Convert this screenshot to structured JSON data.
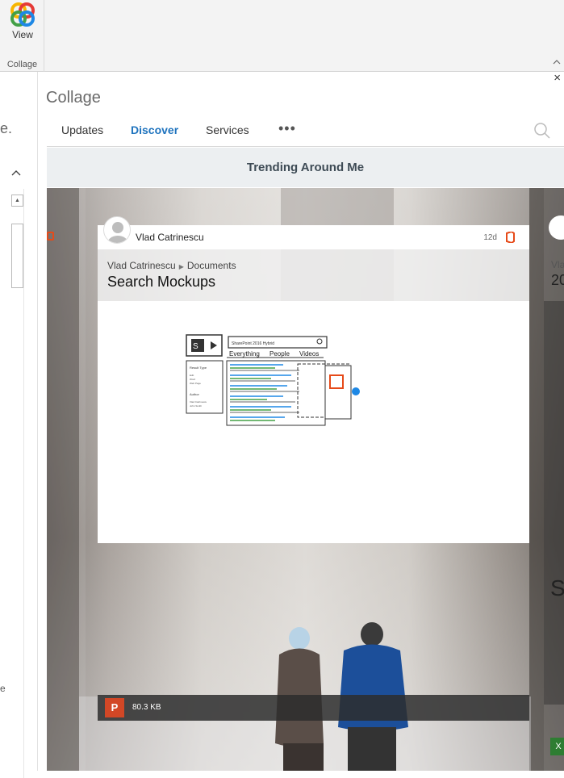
{
  "ribbon": {
    "view_label": "View",
    "group_label": "Collage"
  },
  "left_pane": {
    "partial_text": "e.",
    "partial_text_2": "e"
  },
  "panel": {
    "title": "Collage",
    "close_glyph": "×",
    "tabs": [
      {
        "label": "Updates",
        "active": false
      },
      {
        "label": "Discover",
        "active": true
      },
      {
        "label": "Services",
        "active": false
      }
    ],
    "more_glyph": "•••",
    "section_title": "Trending Around Me"
  },
  "card": {
    "author": "Vlad Catrinescu",
    "age": "12d",
    "breadcrumb": [
      "Vlad Catrinescu",
      "Documents"
    ],
    "title": "Search Mockups",
    "file_type": "P",
    "file_size": "80.3 KB"
  },
  "side_card_right": {
    "author_partial": "Vla",
    "title_partial": "20",
    "partial_char": "S"
  },
  "mockup": {
    "search_text": "SharePoint 2016 Hybrid",
    "tabs": [
      "Everything",
      "People",
      "Videos"
    ],
    "refiner_title": "Result Type",
    "refiner_items": [
      "Edit",
      "Word",
      "Web Page"
    ],
    "author_title": "Author",
    "author_items": [
      "Vlad Catrinescu",
      "John Smith"
    ]
  },
  "colors": {
    "accent": "#1e73be",
    "office_red": "#e64a19",
    "ppt_red": "#d24726"
  }
}
